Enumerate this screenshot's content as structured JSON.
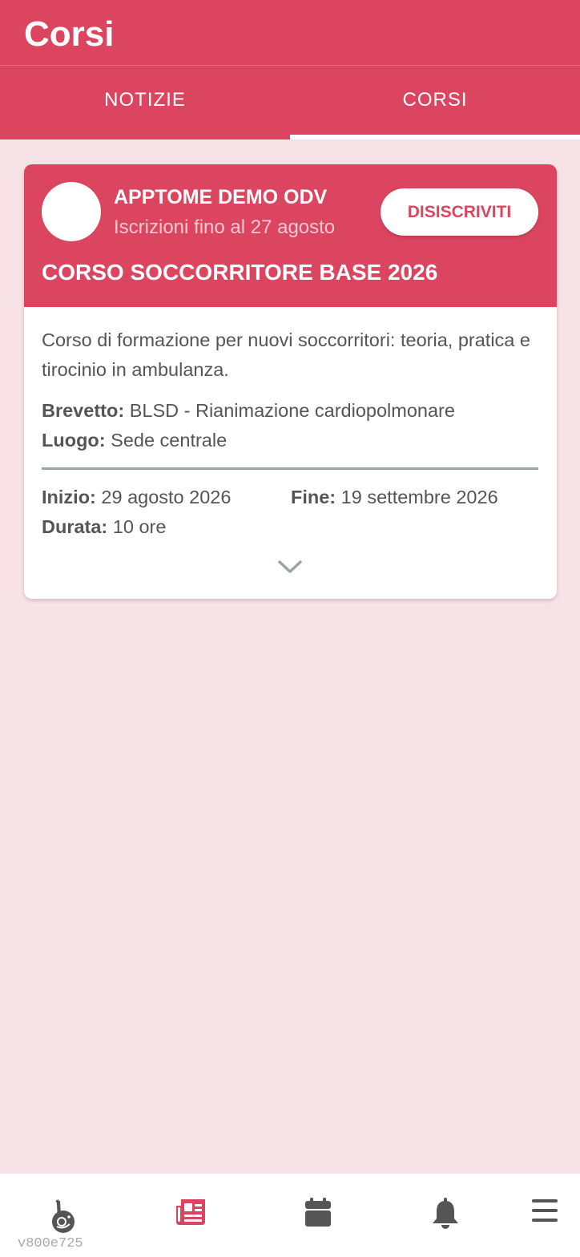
{
  "header": {
    "title": "Corsi",
    "tabs": [
      {
        "label": "NOTIZIE",
        "active": false
      },
      {
        "label": "CORSI",
        "active": true
      }
    ]
  },
  "course_card": {
    "organization": "APPTOME DEMO ODV",
    "deadline": "Iscrizioni fino al 27 agosto",
    "action_label": "DISISCRIVITI",
    "title": "CORSO SOCCORRITORE BASE 2026",
    "description": "Corso di formazione per nuovi soccorritori: teoria, pratica e tirocinio in ambulanza.",
    "brevetto_label": "Brevetto:",
    "brevetto_value": "BLSD - Rianimazione cardiopolmonare",
    "luogo_label": "Luogo:",
    "luogo_value": "Sede centrale",
    "inizio_label": "Inizio:",
    "inizio_value": "29 agosto 2026",
    "fine_label": "Fine:",
    "fine_value": "19 settembre 2026",
    "durata_label": "Durata:",
    "durata_value": "10 ore",
    "expand_icon": "chevron-down-icon"
  },
  "bottom_nav": {
    "items": [
      {
        "name": "home",
        "icon": "hand-logo-icon",
        "active": false
      },
      {
        "name": "news",
        "icon": "newspaper-icon",
        "active": true
      },
      {
        "name": "calendar",
        "icon": "calendar-icon",
        "active": false
      },
      {
        "name": "notifications",
        "icon": "bell-icon",
        "active": false
      },
      {
        "name": "menu",
        "icon": "menu-icon",
        "active": false
      }
    ],
    "version": "v800e725"
  },
  "colors": {
    "primary": "#db4560",
    "background": "#f7e2e7",
    "separator": "#97a69f",
    "text": "#555555",
    "icon": "#555555"
  }
}
